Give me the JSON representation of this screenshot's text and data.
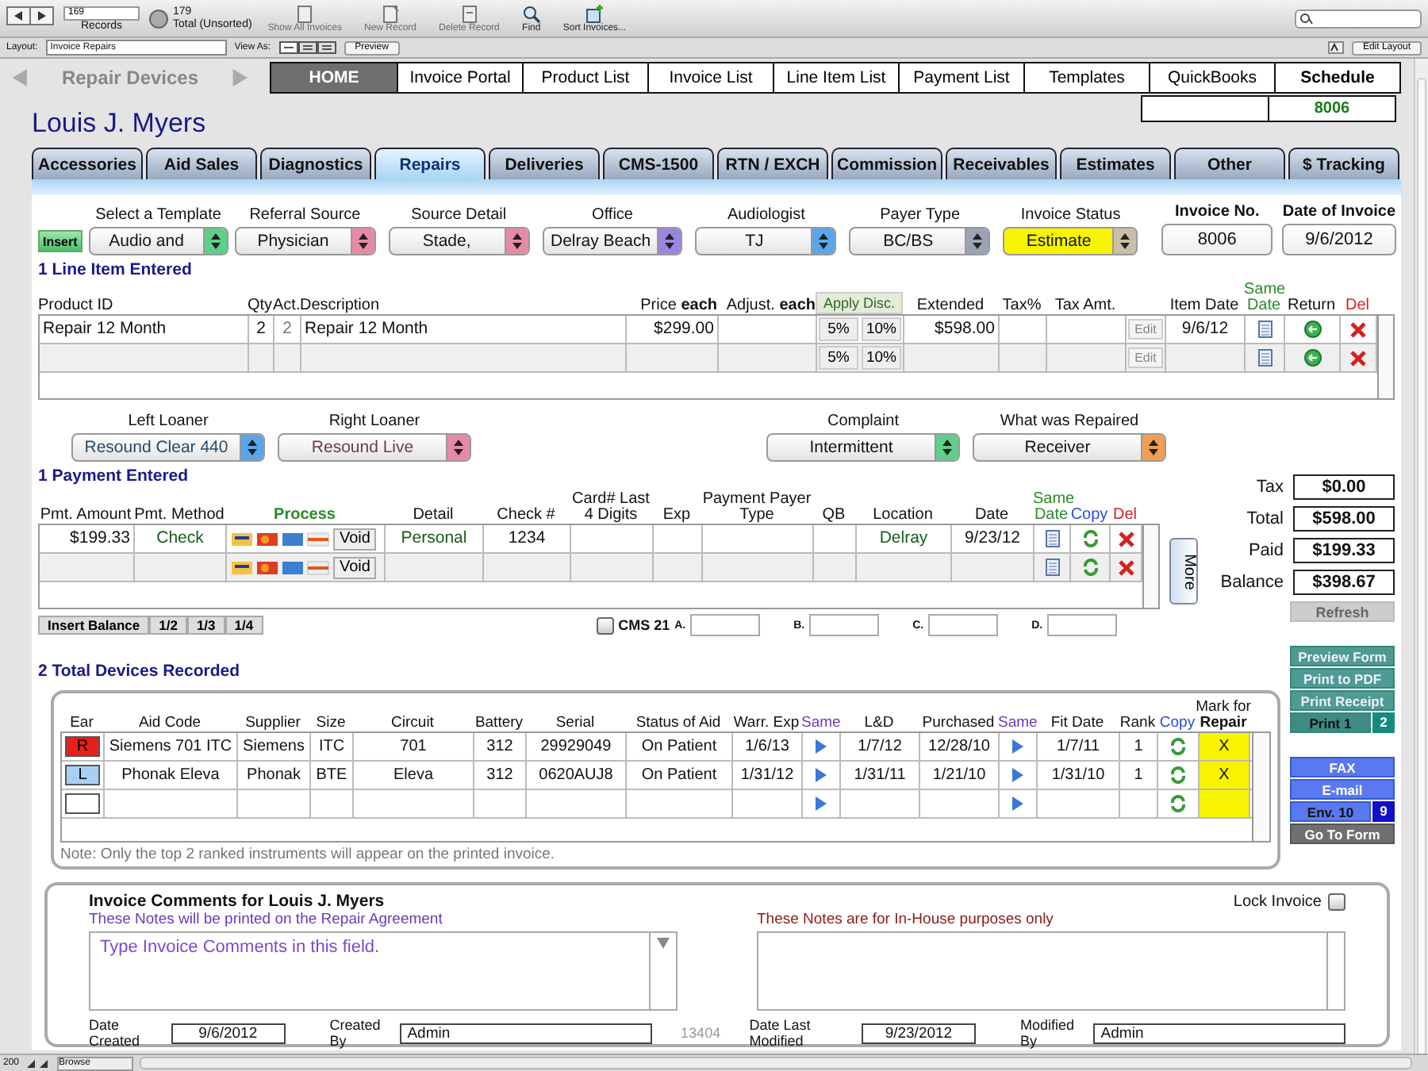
{
  "toolbar": {
    "record": "169",
    "records_label": "Records",
    "total": "179",
    "total_label": "Total (Unsorted)",
    "buttons": [
      {
        "label": "Show All Invoices",
        "disabled": true
      },
      {
        "label": "New Record",
        "disabled": true
      },
      {
        "label": "Delete Record",
        "disabled": true
      },
      {
        "label": "Find",
        "disabled": false
      },
      {
        "label": "Sort Invoices...",
        "disabled": false
      }
    ]
  },
  "layout_bar": {
    "layout_label": "Layout:",
    "layout": "Invoice Repairs",
    "view_label": "View As:",
    "preview": "Preview",
    "edit_layout": "Edit Layout"
  },
  "nav": {
    "title": "Repair Devices",
    "buttons": [
      {
        "label": "HOME",
        "selected": true
      },
      {
        "label": "Invoice Portal",
        "selected": false
      },
      {
        "label": "Product List",
        "selected": false
      },
      {
        "label": "Invoice List",
        "selected": false
      },
      {
        "label": "Line Item List",
        "selected": false
      },
      {
        "label": "Payment List",
        "selected": false
      },
      {
        "label": "Templates",
        "selected": false
      },
      {
        "label": "QuickBooks",
        "selected": false
      },
      {
        "label": "Schedule",
        "selected": false
      }
    ]
  },
  "patient_name": "Louis J. Myers",
  "record_box": "8006",
  "tabs": [
    {
      "label": "Accessories",
      "selected": false
    },
    {
      "label": "Aid Sales",
      "selected": false
    },
    {
      "label": "Diagnostics",
      "selected": false
    },
    {
      "label": "Repairs",
      "selected": true
    },
    {
      "label": "Deliveries",
      "selected": false
    },
    {
      "label": "CMS-1500",
      "selected": false
    },
    {
      "label": "RTN / EXCH",
      "selected": false
    },
    {
      "label": "Commission",
      "selected": false
    },
    {
      "label": "Receivables",
      "selected": false
    },
    {
      "label": "Estimates",
      "selected": false
    },
    {
      "label": "Other",
      "selected": false
    },
    {
      "label": "$ Tracking",
      "selected": false
    }
  ],
  "header": {
    "insert": "Insert",
    "dropdowns": [
      {
        "label": "Select a Template",
        "value": "Audio and",
        "color": "#5fcf8a",
        "highlighted": false
      },
      {
        "label": "Referral Source",
        "value": "Physician",
        "color": "#e68aa6",
        "highlighted": false
      },
      {
        "label": "Source Detail",
        "value": "Stade,",
        "color": "#e68aa6",
        "highlighted": false
      },
      {
        "label": "Office",
        "value": "Delray Beach",
        "color": "#9a86e0",
        "highlighted": false
      },
      {
        "label": "Audiologist",
        "value": "TJ",
        "color": "#5aa6ea",
        "highlighted": false
      },
      {
        "label": "Payer Type",
        "value": "BC/BS",
        "color": "#9aa4b4",
        "highlighted": false
      },
      {
        "label": "Invoice Status",
        "value": "Estimate",
        "color": "#c8bfa6",
        "highlighted": true
      }
    ],
    "invoice_no": {
      "label": "Invoice No.",
      "value": "8006"
    },
    "invoice_date": {
      "label": "Date of Invoice",
      "value": "9/6/2012"
    }
  },
  "line_items": {
    "title": "1 Line Item Entered",
    "headers": {
      "product_id": "Product ID",
      "qty": "Qty",
      "act": "Act.",
      "description": "Description",
      "price": "Price **each**",
      "adjust": "Adjust. **each**",
      "disc": "Apply Disc.",
      "extended": "Extended",
      "tax_pct": "Tax%",
      "tax_amt": "Tax Amt.",
      "item_date": "Item Date",
      "same_date": "Same Date",
      "return": "Return",
      "del": "Del"
    },
    "rows": [
      {
        "product_id": "Repair 12 Month",
        "qty": "2",
        "act": "2",
        "description": "Repair 12 Month",
        "price": "$299.00",
        "disc": [
          "5%",
          "10%"
        ],
        "extended": "$598.00",
        "edit": "Edit",
        "item_date": "9/6/12"
      },
      {
        "disc": [
          "5%",
          "10%"
        ],
        "edit": "Edit"
      }
    ]
  },
  "loaners": [
    {
      "label": "Left Loaner",
      "value": "Resound Clear 440",
      "color": "#5aa6ea"
    },
    {
      "label": "Right Loaner",
      "value": "Resound Live",
      "color": "#e68aa6"
    }
  ],
  "repair_fields": [
    {
      "label": "Complaint",
      "value": "Intermittent",
      "color": "#5fcf8a"
    },
    {
      "label": "What was Repaired",
      "value": "Receiver",
      "color": "#f0a050"
    }
  ],
  "payments": {
    "title": "1 Payment Entered",
    "headers": {
      "amount": "Pmt. Amount",
      "method": "Pmt. Method",
      "process": "Process",
      "detail": "Detail",
      "check": "Check #",
      "card": "Card# Last 4 Digits",
      "exp": "Exp",
      "payer": "Payment Payer Type",
      "qb": "QB",
      "location": "Location",
      "date": "Date",
      "same_date": "Same Date",
      "copy": "Copy",
      "del": "Del"
    },
    "rows": [
      {
        "amount": "$199.33",
        "method": "Check",
        "void": "Void",
        "detail": "Personal",
        "check": "1234",
        "location": "Delray",
        "date": "9/23/12"
      },
      {
        "void": "Void"
      }
    ],
    "more": "More",
    "split_buttons": [
      "Insert Balance",
      "1/2",
      "1/3",
      "1/4"
    ],
    "cms": {
      "label": "CMS 21",
      "checked": false,
      "fields": [
        "A.",
        "B.",
        "C.",
        "D."
      ]
    }
  },
  "totals": [
    {
      "label": "Tax",
      "value": "$0.00"
    },
    {
      "label": "Total",
      "value": "$598.00"
    },
    {
      "label": "Paid",
      "value": "$199.33"
    },
    {
      "label": "Balance",
      "value": "$398.67"
    }
  ],
  "refresh": "Refresh",
  "print_buttons": [
    "Preview Form",
    "Print to PDF",
    "Print Receipt"
  ],
  "print": {
    "label": "Print 1",
    "count": "2"
  },
  "send_buttons": [
    "FAX",
    "E-mail"
  ],
  "envelope": {
    "label": "Env. 10",
    "count": "9"
  },
  "go_to_form": "Go To Form",
  "devices": {
    "title": "2 Total Devices Recorded",
    "headers": {
      "ear": "Ear",
      "aid_code": "Aid Code",
      "supplier": "Supplier",
      "size": "Size",
      "circuit": "Circuit",
      "battery": "Battery",
      "serial": "Serial",
      "status": "Status of Aid",
      "warr": "Warr. Exp",
      "same1": "Same",
      "ld": "L&D",
      "purchased": "Purchased",
      "same2": "Same",
      "fit": "Fit Date",
      "rank": "Rank",
      "copy": "Copy",
      "mark1": "Mark for",
      "mark2": "Repair"
    },
    "rows": [
      {
        "ear": "R",
        "color": "#e8201c",
        "aid_code": "Siemens 701 ITC",
        "supplier": "Siemens",
        "size": "ITC",
        "circuit": "701",
        "battery": "312",
        "serial": "29929049",
        "status": "On Patient",
        "warr": "1/6/13",
        "ld": "1/7/12",
        "purchased": "12/28/10",
        "fit": "1/7/11",
        "rank": "1",
        "mark": "X"
      },
      {
        "ear": "L",
        "color": "#a8d0f4",
        "aid_code": "Phonak Eleva",
        "supplier": "Phonak",
        "size": "BTE",
        "circuit": "Eleva",
        "battery": "312",
        "serial": "0620AUJ8",
        "status": "On Patient",
        "warr": "1/31/12",
        "ld": "1/31/11",
        "purchased": "1/21/10",
        "fit": "1/31/10",
        "rank": "1",
        "mark": "X"
      },
      {
        "color": "#ffffff"
      }
    ],
    "note": "Note: Only the top 2 ranked instruments will appear on the printed invoice."
  },
  "comments": {
    "title": "Invoice Comments for Louis J. Myers",
    "lock_label": "Lock Invoice",
    "locked": false,
    "print_note": "These Notes will be printed on the Repair Agreement",
    "placeholder": "Type Invoice Comments in this field.",
    "inhouse_note": "These Notes are for In-House purposes only",
    "date_created_label": "Date Created",
    "date_created": "9/6/2012",
    "created_by_label": "Created By",
    "created_by": "Admin",
    "record_id": "13404",
    "modified_label": "Date Last Modified",
    "modified": "9/23/2012",
    "modified_by_label": "Modified By",
    "modified_by": "Admin"
  },
  "status_bar": {
    "zoom": "200",
    "mode": "Browse"
  }
}
